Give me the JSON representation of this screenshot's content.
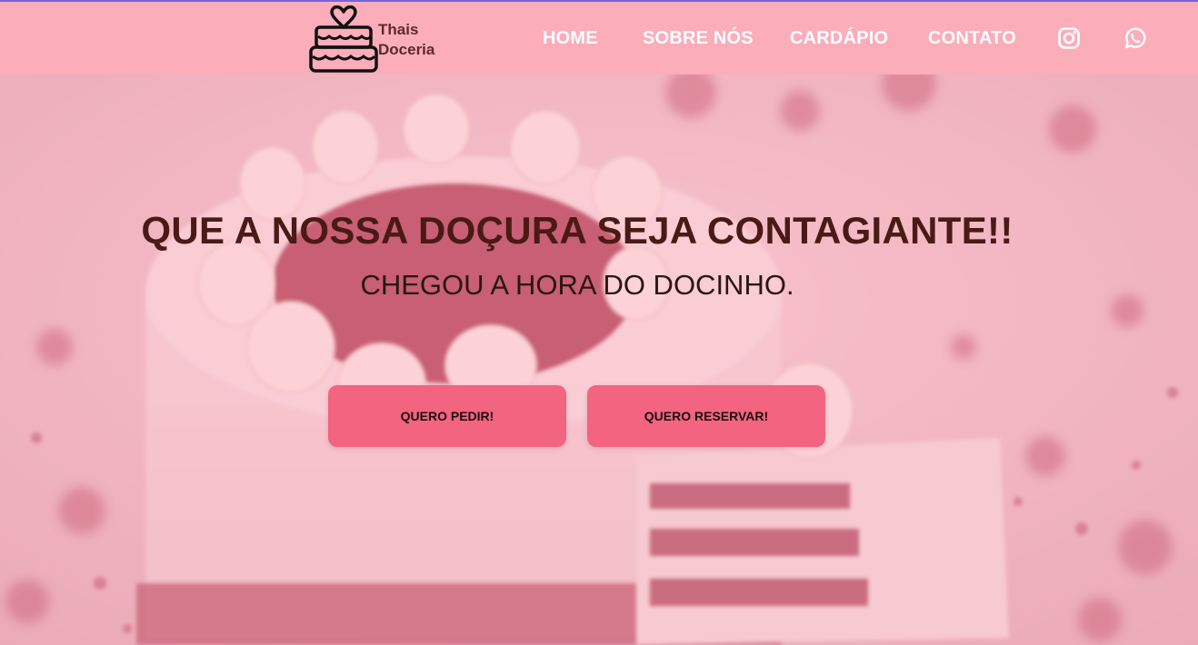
{
  "brand": {
    "line1": "Thais",
    "line2": "Doceria",
    "logo_icon": "cake-icon"
  },
  "nav": {
    "items": [
      {
        "label": "HOME"
      },
      {
        "label": "SOBRE NÓS"
      },
      {
        "label": "CARDÁPIO"
      },
      {
        "label": "CONTATO"
      }
    ],
    "social": [
      {
        "icon": "instagram-icon"
      },
      {
        "icon": "whatsapp-icon"
      }
    ]
  },
  "hero": {
    "headline": "QUE A NOSSA DOÇURA SEJA CONTAGIANTE!!",
    "subheadline": "CHEGOU A HORA DO DOCINHO.",
    "buttons": [
      {
        "label": "QUERO PEDIR!"
      },
      {
        "label": "QUERO RESERVAR!"
      }
    ]
  },
  "colors": {
    "header_bg": "#fbadba",
    "button_bg": "#f2647f",
    "headline_text": "#4a1a16",
    "nav_text": "#ffffff"
  }
}
